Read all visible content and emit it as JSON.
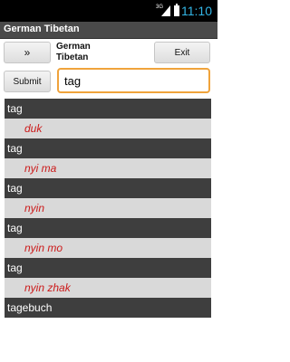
{
  "status_bar": {
    "network_label": "3G",
    "time": "11:10"
  },
  "app": {
    "title": "German Tibetan"
  },
  "toolbar": {
    "swap_label": "»",
    "language_line1": "German",
    "language_line2": "Tibetan",
    "exit_label": "Exit",
    "submit_label": "Submit"
  },
  "search": {
    "value": "tag",
    "placeholder": ""
  },
  "results": [
    {
      "type": "head",
      "text": "tag"
    },
    {
      "type": "trans",
      "text": "duk"
    },
    {
      "type": "head",
      "text": "tag"
    },
    {
      "type": "trans",
      "text": "nyi ma"
    },
    {
      "type": "head",
      "text": "tag"
    },
    {
      "type": "trans",
      "text": "nyin"
    },
    {
      "type": "head",
      "text": "tag"
    },
    {
      "type": "trans",
      "text": "nyin mo"
    },
    {
      "type": "head",
      "text": "tag"
    },
    {
      "type": "trans",
      "text": "nyin zhak"
    },
    {
      "type": "head",
      "text": "tagebuch"
    }
  ],
  "colors": {
    "status_accent": "#33b5e5",
    "title_bar": "#4a4a4a",
    "search_border": "#f0a33b",
    "row_head": "#3e3e3e",
    "row_trans": "#d9d9d9",
    "translation_text": "#cc1a1a"
  }
}
